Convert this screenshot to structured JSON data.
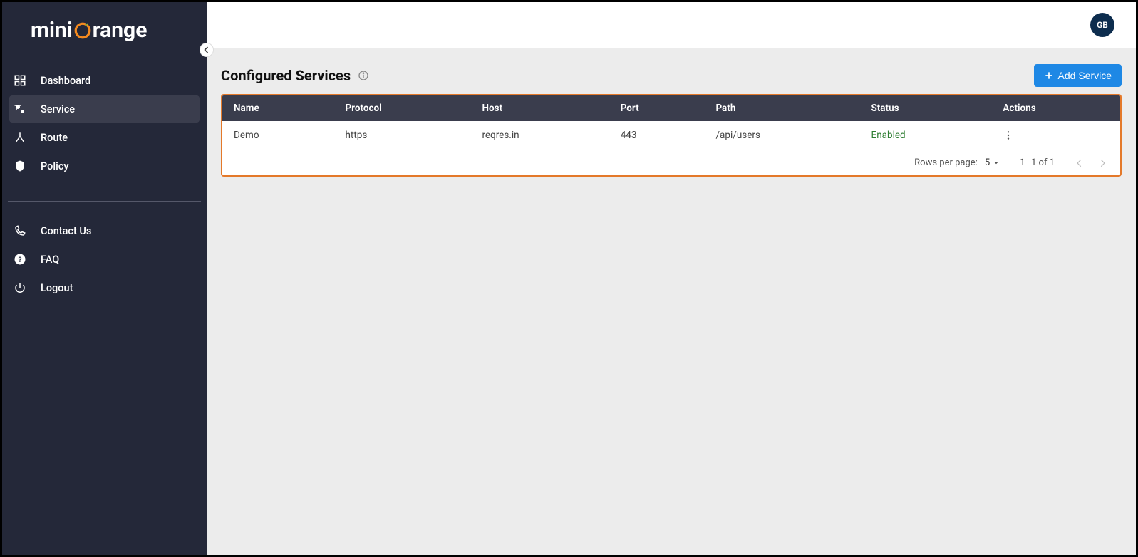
{
  "brand": {
    "part1": "mini",
    "part2": "range"
  },
  "sidebar": {
    "items": [
      {
        "label": "Dashboard"
      },
      {
        "label": "Service"
      },
      {
        "label": "Route"
      },
      {
        "label": "Policy"
      }
    ],
    "secondary": [
      {
        "label": "Contact Us"
      },
      {
        "label": "FAQ"
      },
      {
        "label": "Logout"
      }
    ]
  },
  "header": {
    "avatar_initials": "GB"
  },
  "page": {
    "title": "Configured Services",
    "add_button": "Add Service"
  },
  "table": {
    "columns": [
      "Name",
      "Protocol",
      "Host",
      "Port",
      "Path",
      "Status",
      "Actions"
    ],
    "rows": [
      {
        "name": "Demo",
        "protocol": "https",
        "host": "reqres.in",
        "port": "443",
        "path": "/api/users",
        "status": "Enabled"
      }
    ],
    "footer": {
      "rows_per_page_label": "Rows per page:",
      "rows_per_page_value": "5",
      "range_text": "1–1 of 1"
    }
  }
}
